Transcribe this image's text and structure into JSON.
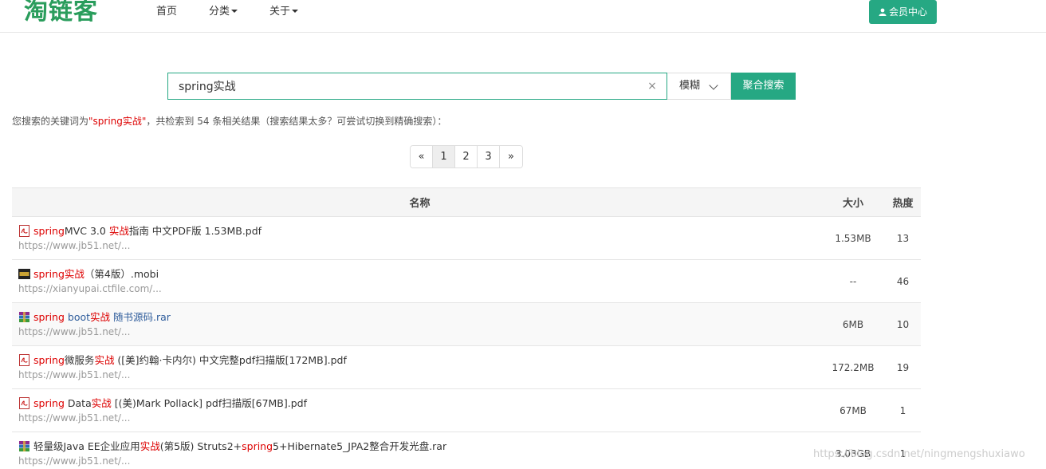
{
  "header": {
    "logo": "淘链客",
    "nav": {
      "home": "首页",
      "category": "分类",
      "about": "关于"
    },
    "member_button": "会员中心"
  },
  "search": {
    "value": "spring实战",
    "mode": "模糊",
    "button": "聚合搜索"
  },
  "summary": {
    "prefix": "您搜索的关键词为",
    "keyword": "\"spring实战\"",
    "suffix": "，共检索到 54 条相关结果（搜索结果太多？可尝试切换到精确搜索）："
  },
  "pagination": {
    "prev": "«",
    "pages": [
      "1",
      "2",
      "3"
    ],
    "next": "»",
    "current": "1"
  },
  "table": {
    "headers": {
      "name": "名称",
      "size": "大小",
      "hot": "热度"
    },
    "rows": [
      {
        "icon": "pdf-icon",
        "parts": [
          [
            "spring",
            "hl"
          ],
          [
            "MVC 3.0 ",
            ""
          ],
          [
            "实战",
            "hl"
          ],
          [
            "指南 中文PDF版 1.53MB.pdf",
            ""
          ]
        ],
        "url": "https://www.jb51.net/...",
        "size": "1.53MB",
        "hot": "13"
      },
      {
        "icon": "mobi-icon",
        "parts": [
          [
            "spring实战",
            "hl"
          ],
          [
            "（第4版）.mobi",
            ""
          ]
        ],
        "url": "https://xianyupai.ctfile.com/...",
        "size": "--",
        "hot": "46"
      },
      {
        "icon": "rar-icon",
        "parts": [
          [
            "spring",
            "hl"
          ],
          [
            " boot",
            "blue"
          ],
          [
            "实战",
            "hl"
          ],
          [
            " 随书源码.rar",
            "blue"
          ]
        ],
        "url": "https://www.jb51.net/...",
        "size": "6MB",
        "hot": "10"
      },
      {
        "icon": "pdf-icon",
        "parts": [
          [
            "spring",
            "hl"
          ],
          [
            "微服务",
            ""
          ],
          [
            "实战",
            "hl"
          ],
          [
            " ([美]约翰·卡内尔) 中文完整pdf扫描版[172MB].pdf",
            ""
          ]
        ],
        "url": "https://www.jb51.net/...",
        "size": "172.2MB",
        "hot": "19"
      },
      {
        "icon": "pdf-icon",
        "parts": [
          [
            "spring",
            "hl"
          ],
          [
            " Data",
            ""
          ],
          [
            "实战",
            "hl"
          ],
          [
            " [(美)Mark Pollack] pdf扫描版[67MB].pdf",
            ""
          ]
        ],
        "url": "https://www.jb51.net/...",
        "size": "67MB",
        "hot": "1"
      },
      {
        "icon": "rar-icon",
        "parts": [
          [
            "轻量级Java EE企业应用",
            ""
          ],
          [
            "实战",
            "hl"
          ],
          [
            "(第5版) Struts2+",
            ""
          ],
          [
            "spring",
            "hl"
          ],
          [
            "5+Hibernate5_JPA2整合开发光盘.rar",
            ""
          ]
        ],
        "url": "https://www.jb51.net/...",
        "size": "3.03GB",
        "hot": "1"
      }
    ]
  },
  "watermark": "https://blog.csdn.net/ningmengshuxiawo",
  "colors": {
    "brand": "#26a883",
    "highlight": "#dd0000",
    "logo": "#2a9d5c"
  }
}
